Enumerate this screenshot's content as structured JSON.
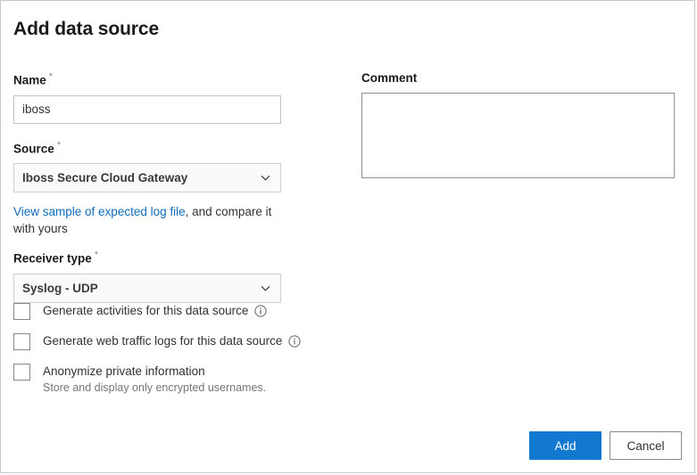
{
  "dialog": {
    "title": "Add data source",
    "required_marker": "*"
  },
  "form": {
    "name": {
      "label": "Name",
      "required": true,
      "value": "iboss",
      "placeholder": ""
    },
    "source": {
      "label": "Source",
      "required": true,
      "selected": "Iboss Secure Cloud Gateway"
    },
    "sample_help": {
      "link_text": "View sample of expected log file",
      "rest_text": ", and compare it with yours"
    },
    "receiver_type": {
      "label": "Receiver type",
      "required": true,
      "selected": "Syslog - UDP"
    },
    "comment": {
      "label": "Comment",
      "value": "",
      "placeholder": ""
    }
  },
  "checkboxes": [
    {
      "label": "Generate activities for this data source",
      "sub": "",
      "checked": false,
      "has_info": true
    },
    {
      "label": "Generate web traffic logs for this data source",
      "sub": "",
      "checked": false,
      "has_info": true
    },
    {
      "label": "Anonymize private information",
      "sub": "Store and display only encrypted usernames.",
      "checked": false,
      "has_info": false
    }
  ],
  "footer": {
    "add_label": "Add",
    "cancel_label": "Cancel"
  },
  "colors": {
    "primary": "#1279d1",
    "link": "#0f6cbd",
    "text": "#323130",
    "muted": "#767676",
    "border": "#c8c8c8"
  }
}
